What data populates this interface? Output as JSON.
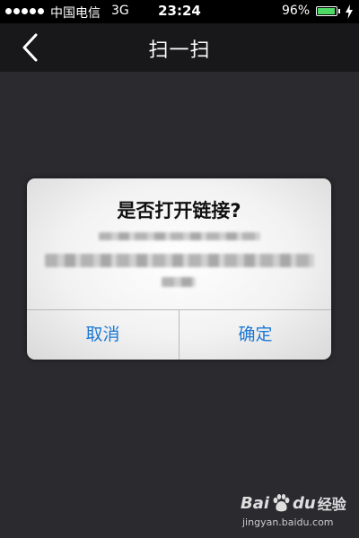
{
  "status_bar": {
    "carrier": "中国电信",
    "network": "3G",
    "time": "23:24",
    "battery_percent": "96%",
    "battery_level": 0.96,
    "battery_color": "#4cd964"
  },
  "nav": {
    "title": "扫一扫",
    "back_icon": "chevron-left-icon"
  },
  "dialog": {
    "title": "是否打开链接?",
    "cancel_label": "取消",
    "confirm_label": "确定",
    "button_color": "#1c78d4"
  },
  "watermark": {
    "brand_left": "Bai",
    "brand_right": "du",
    "suffix": "经验",
    "url": "jingyan.baidu.com"
  }
}
